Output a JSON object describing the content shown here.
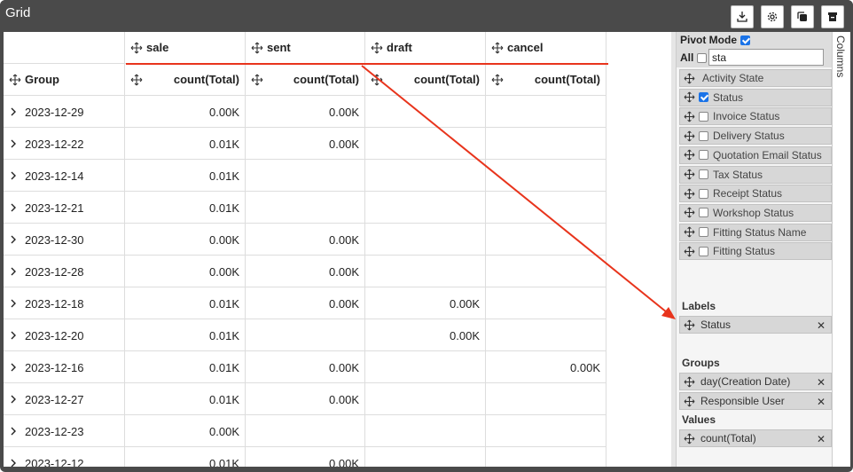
{
  "window": {
    "title": "Grid"
  },
  "toolbar": {
    "buttons": [
      {
        "name": "export-icon"
      },
      {
        "name": "settings-icon"
      },
      {
        "name": "copy-icon"
      },
      {
        "name": "delete-icon"
      }
    ]
  },
  "grid": {
    "pivot_headers": [
      "sale",
      "sent",
      "draft",
      "cancel"
    ],
    "group_header": "Group",
    "value_header": "count(Total)",
    "rows": [
      {
        "group": "2023-12-29",
        "values": [
          "0.00K",
          "0.00K",
          "",
          ""
        ]
      },
      {
        "group": "2023-12-22",
        "values": [
          "0.01K",
          "0.00K",
          "",
          ""
        ]
      },
      {
        "group": "2023-12-14",
        "values": [
          "0.01K",
          "",
          "",
          ""
        ]
      },
      {
        "group": "2023-12-21",
        "values": [
          "0.01K",
          "",
          "",
          ""
        ]
      },
      {
        "group": "2023-12-30",
        "values": [
          "0.00K",
          "0.00K",
          "",
          ""
        ]
      },
      {
        "group": "2023-12-28",
        "values": [
          "0.00K",
          "0.00K",
          "",
          ""
        ]
      },
      {
        "group": "2023-12-18",
        "values": [
          "0.01K",
          "0.00K",
          "0.00K",
          ""
        ]
      },
      {
        "group": "2023-12-20",
        "values": [
          "0.01K",
          "",
          "0.00K",
          ""
        ]
      },
      {
        "group": "2023-12-16",
        "values": [
          "0.01K",
          "0.00K",
          "",
          "0.00K"
        ]
      },
      {
        "group": "2023-12-27",
        "values": [
          "0.01K",
          "0.00K",
          "",
          ""
        ]
      },
      {
        "group": "2023-12-23",
        "values": [
          "0.00K",
          "",
          "",
          ""
        ]
      },
      {
        "group": "2023-12-12",
        "values": [
          "0.01K",
          "0.00K",
          "",
          ""
        ]
      }
    ]
  },
  "panel": {
    "pivot_mode_label": "Pivot Mode",
    "pivot_mode_checked": true,
    "all_label": "All",
    "search_value": "sta",
    "columns": [
      {
        "label": "Activity State",
        "has_checkbox": false,
        "checked": false
      },
      {
        "label": "Status",
        "has_checkbox": true,
        "checked": true
      },
      {
        "label": "Invoice Status",
        "has_checkbox": true,
        "checked": false
      },
      {
        "label": "Delivery Status",
        "has_checkbox": true,
        "checked": false
      },
      {
        "label": "Quotation Email Status",
        "has_checkbox": true,
        "checked": false
      },
      {
        "label": "Tax Status",
        "has_checkbox": true,
        "checked": false
      },
      {
        "label": "Receipt Status",
        "has_checkbox": true,
        "checked": false
      },
      {
        "label": "Workshop Status",
        "has_checkbox": true,
        "checked": false
      },
      {
        "label": "Fitting Status Name",
        "has_checkbox": true,
        "checked": false
      },
      {
        "label": "Fitting Status",
        "has_checkbox": true,
        "checked": false
      }
    ],
    "labels_title": "Labels",
    "labels": [
      "Status"
    ],
    "groups_title": "Groups",
    "groups": [
      "day(Creation Date)",
      "Responsible User"
    ],
    "values_title": "Values",
    "values": [
      "count(Total)"
    ],
    "side_tab_label": "Columns"
  },
  "colors": {
    "annotation": "#e8341c",
    "checkbox": "#1a73e8",
    "titlebar": "#4a4a4a"
  }
}
